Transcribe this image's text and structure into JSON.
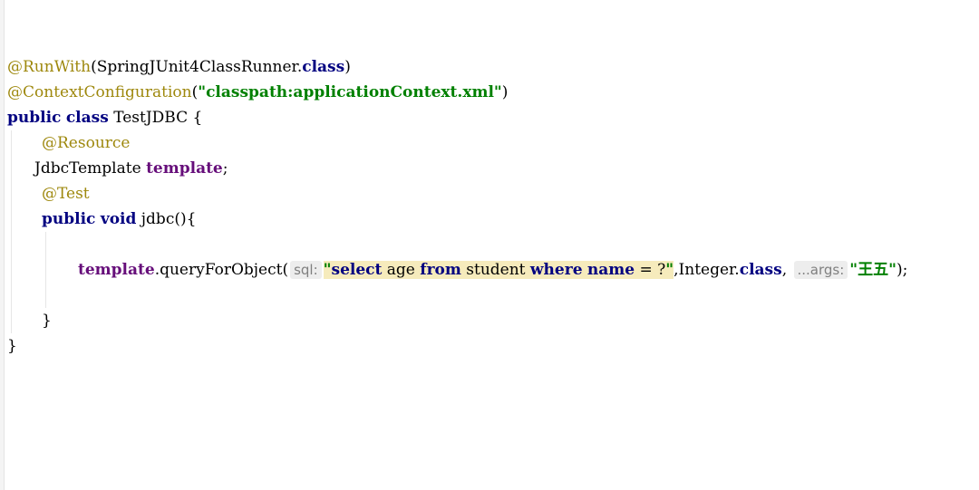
{
  "code": {
    "l1": {
      "ann": "@RunWith",
      "a": "(SpringJUnit4ClassRunner.",
      "kw": "class",
      "b": ")"
    },
    "l2": {
      "ann": "@ContextConfiguration",
      "a": "(",
      "str": "\"classpath:applicationContext.xml\"",
      "b": ")"
    },
    "l3": {
      "kw1": "public",
      "kw2": "class",
      "name": "TestJDBC",
      "brace": "{"
    },
    "l4": {
      "ann": "@Resource"
    },
    "l5": {
      "type": "JdbcTemplate",
      "field": "template",
      "semi": ";"
    },
    "l6": {
      "ann": "@Test"
    },
    "l7": {
      "kw1": "public",
      "kw2": "void",
      "name": "jdbc(){"
    },
    "l8": {
      "field": "template",
      "method": ".queryForObject(",
      "hint_sql": "sql:",
      "q_open": "\"",
      "s1": "select",
      "s2": " age ",
      "s3": "from",
      "s4": " student ",
      "s5": "where",
      "s6": " ",
      "s7": "name",
      "s8": " = ?",
      "q_close": "\"",
      "mid": ",Integer.",
      "kw": "class",
      "comma": ",",
      "hint_args": "...args:",
      "str2": "\"王五\"",
      "end": ");"
    },
    "l9": {
      "brace": "}"
    },
    "l10": {
      "brace": "}"
    }
  }
}
